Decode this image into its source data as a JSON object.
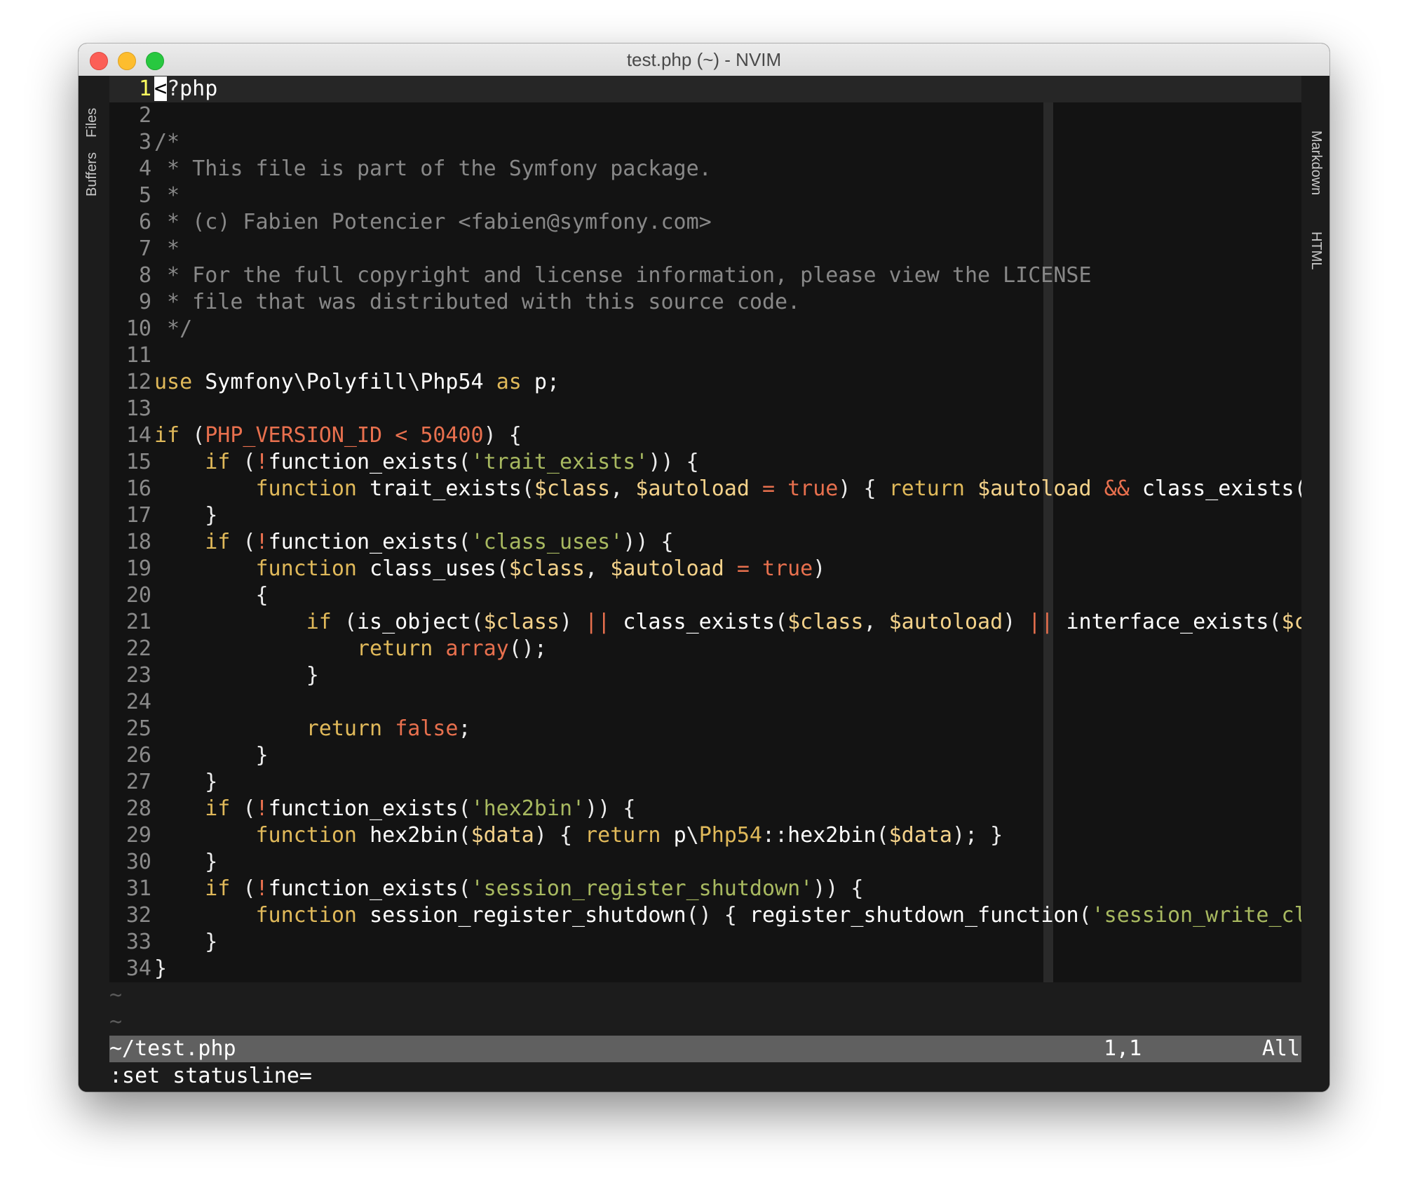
{
  "window": {
    "title": "test.php (~) - NVIM",
    "controls": [
      "close",
      "minimize",
      "maximize"
    ]
  },
  "sidebar_left": {
    "tabs": [
      "Files",
      "Buffers"
    ]
  },
  "sidebar_right": {
    "tabs": [
      "Markdown",
      "HTML"
    ]
  },
  "editor": {
    "filename": "~/test.php",
    "current_line": 1,
    "lines": [
      "<?php",
      "",
      "/*",
      " * This file is part of the Symfony package.",
      " *",
      " * (c) Fabien Potencier <fabien@symfony.com>",
      " *",
      " * For the full copyright and license information, please view the LICENSE",
      " * file that was distributed with this source code.",
      " */",
      "",
      "use Symfony\\Polyfill\\Php54 as p;",
      "",
      "if (PHP_VERSION_ID < 50400) {",
      "    if (!function_exists('trait_exists')) {",
      "        function trait_exists($class, $autoload = true) { return $autoload && class_exists($class, $a#",
      "    }",
      "    if (!function_exists('class_uses')) {",
      "        function class_uses($class, $autoload = true)",
      "        {",
      "            if (is_object($class) || class_exists($class, $autoload) || interface_exists($class, fals#",
      "                return array();",
      "            }",
      "",
      "            return false;",
      "        }",
      "    }",
      "    if (!function_exists('hex2bin')) {",
      "        function hex2bin($data) { return p\\Php54::hex2bin($data); }",
      "    }",
      "    if (!function_exists('session_register_shutdown')) {",
      "        function session_register_shutdown() { register_shutdown_function('session_write_close'); }",
      "    }",
      "}"
    ],
    "tilde_lines": [
      "~",
      "~"
    ]
  },
  "statusline": {
    "filename": "~/test.php",
    "position": "1,1",
    "scroll": "All"
  },
  "cmdline": ":set statusline=",
  "colors": {
    "comment": "#888888",
    "keyword": "#e0b95a",
    "string": "#a8b960",
    "constant": "#e8704e",
    "variable": "#f4d28a",
    "line_number_current": "#ffff5f"
  }
}
